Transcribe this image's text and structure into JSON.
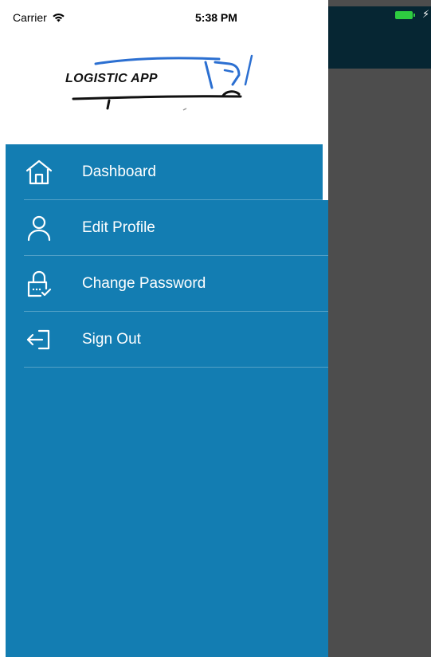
{
  "status_bar": {
    "carrier": "Carrier",
    "time": "5:38 PM"
  },
  "header": {
    "logo_text": "LOGISTIC APP"
  },
  "menu": {
    "items": [
      {
        "label": "Dashboard",
        "icon": "home-icon"
      },
      {
        "label": "Edit Profile",
        "icon": "user-icon"
      },
      {
        "label": "Change Password",
        "icon": "lock-icon"
      },
      {
        "label": "Sign Out",
        "icon": "sign-out-icon"
      }
    ]
  },
  "colors": {
    "drawer_blue": "#137db2",
    "overlay_gray": "#4d4d4d",
    "header_dark": "#062633",
    "battery_green": "#2ecc40"
  }
}
